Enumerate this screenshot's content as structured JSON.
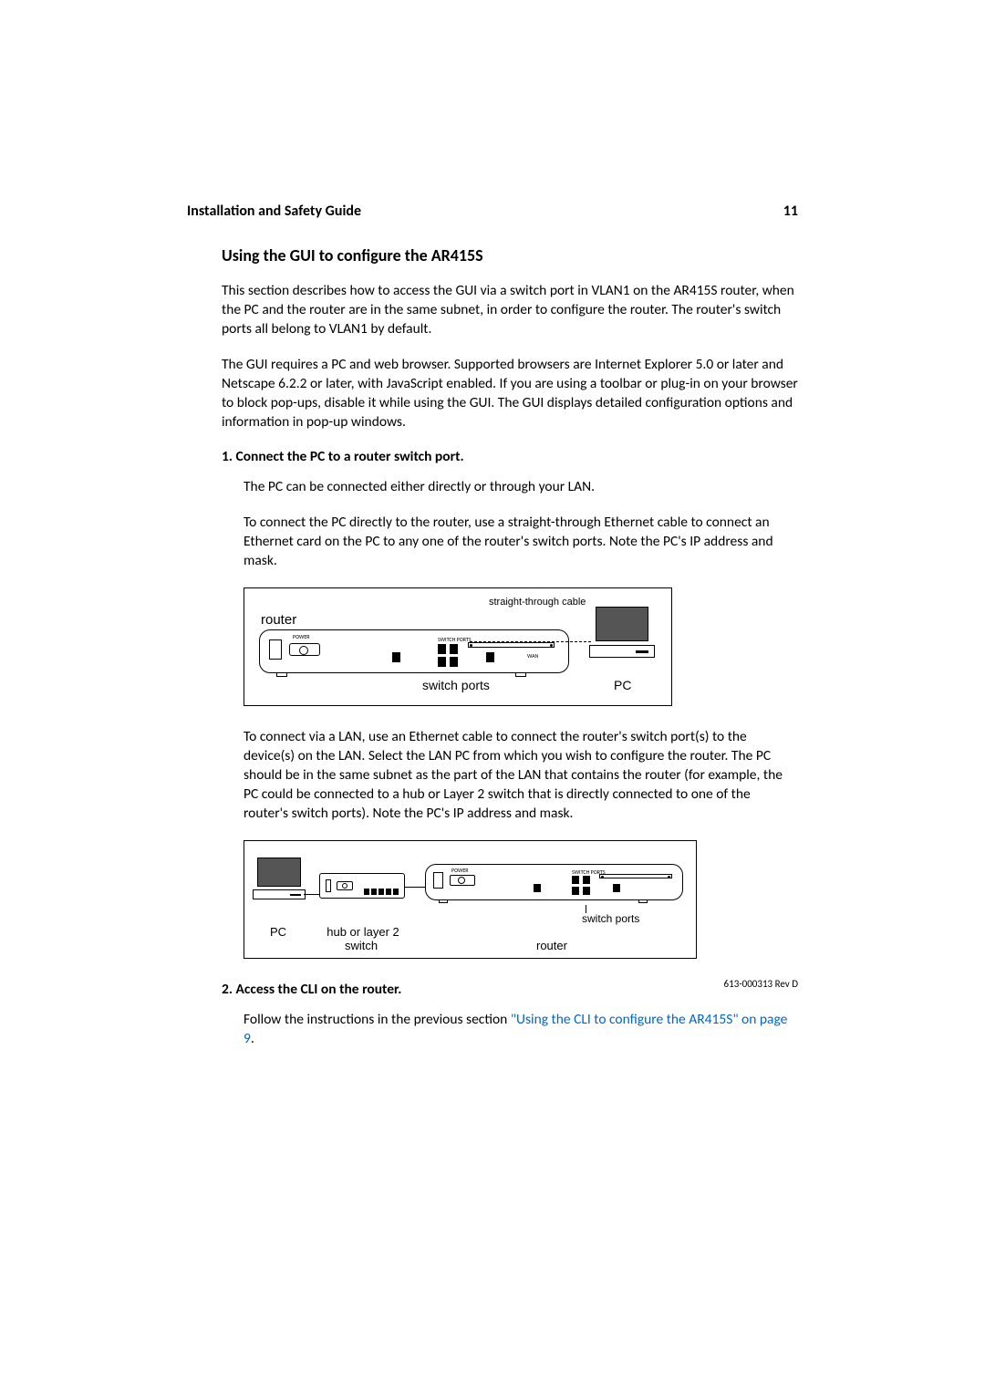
{
  "header": {
    "doc_title": "Installation and Safety Guide",
    "page_number": "11"
  },
  "section": {
    "title": "Using the GUI to configure the AR415S",
    "para1": "This section describes how to access the GUI via a switch port in VLAN1 on the AR415S router, when the PC and the router are in the same subnet, in order to configure the router. The router's switch ports all belong to VLAN1 by default.",
    "para2": "The GUI requires a PC and web browser. Supported browsers are Internet Explorer 5.0 or later and Netscape 6.2.2 or later, with JavaScript enabled. If you are using a toolbar or plug-in on your browser to block pop-ups, disable it while using the GUI. The GUI displays detailed configuration options and information in pop-up windows."
  },
  "step1": {
    "title": "1.  Connect the PC to a router switch port.",
    "body1": "The PC can be connected either directly or through your LAN.",
    "body2": "To connect the PC directly to the router, use a straight-through Ethernet cable to connect an Ethernet card on the PC to any one of the router's switch ports. Note the PC's IP address and mask.",
    "body3": "To connect via a LAN, use an Ethernet cable to connect the router's switch port(s) to the device(s) on the LAN. Select the LAN PC from which you wish to configure the router. The PC should be in the same subnet as the part of the LAN that contains the router (for example, the PC could be connected to a hub or Layer 2 switch that is directly connected to one of the router's switch ports). Note the PC's IP address and mask."
  },
  "diagram1": {
    "router_label": "router",
    "cable_label": "straight-through cable",
    "switch_ports_label": "switch ports",
    "pc_label": "PC",
    "tiny_power": "POWER",
    "tiny_switch": "SWITCH PORTS",
    "tiny_wan": "WAN"
  },
  "diagram2": {
    "pc_label": "PC",
    "hub_label_line1": "hub or layer 2",
    "hub_label_line2": "switch",
    "router_label": "router",
    "switch_ports_label": "switch ports",
    "tiny_power": "POWER",
    "tiny_switch": "SWITCH PORTS"
  },
  "step2": {
    "title": "2.  Access the CLI on the router.",
    "body_prefix": "Follow the instructions in the previous section ",
    "link_text": "\"Using the CLI to configure the AR415S\" on page 9",
    "body_suffix": "."
  },
  "footer": {
    "rev": "613-000313 Rev D"
  }
}
